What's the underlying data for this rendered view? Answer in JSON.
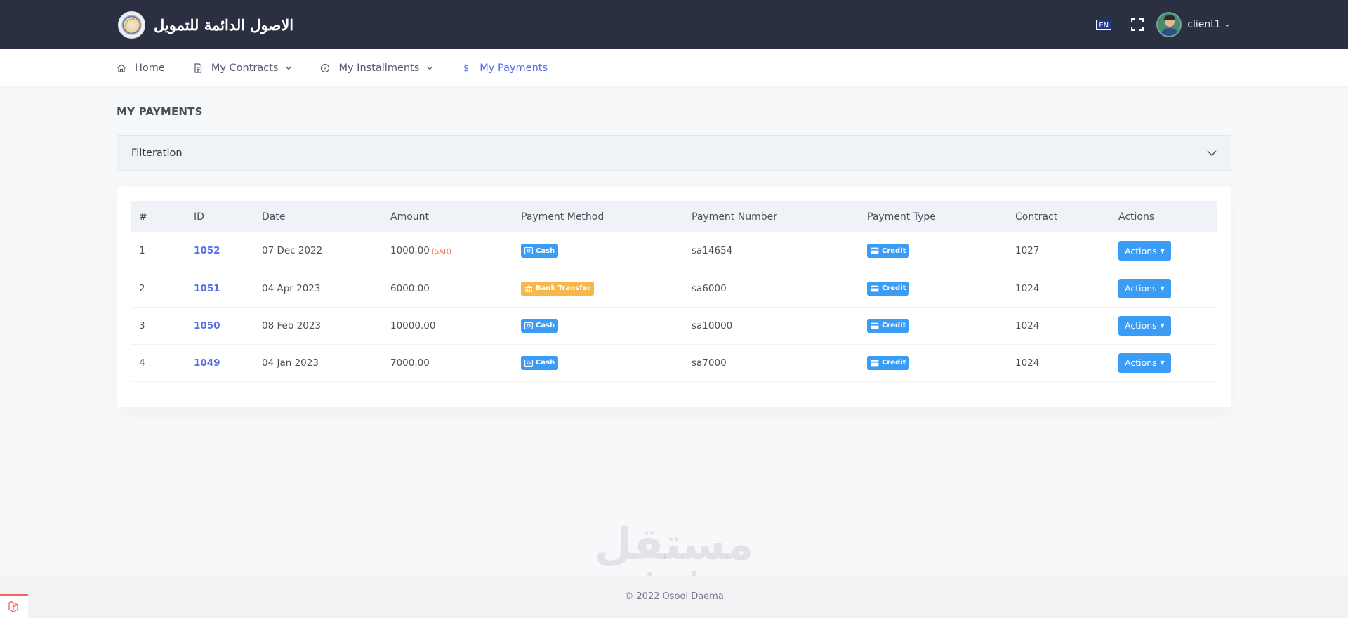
{
  "header": {
    "brand_text": "الاصول الدائمة للتمويل",
    "language": "EN",
    "user_name": "client1"
  },
  "nav": {
    "items": [
      {
        "label": "Home",
        "icon": "home-icon",
        "dropdown": false,
        "active": false
      },
      {
        "label": "My Contracts",
        "icon": "document-icon",
        "dropdown": true,
        "active": false
      },
      {
        "label": "My Installments",
        "icon": "coin-icon",
        "dropdown": true,
        "active": false
      },
      {
        "label": "My Payments",
        "icon": "dollar-icon",
        "dropdown": false,
        "active": true
      }
    ]
  },
  "page": {
    "title": "MY PAYMENTS",
    "filter_label": "Filteration"
  },
  "table": {
    "columns": [
      "#",
      "ID",
      "Date",
      "Amount",
      "Payment Method",
      "Payment Number",
      "Payment Type",
      "Contract",
      "Actions"
    ],
    "rows": [
      {
        "index": "1",
        "id": "1052",
        "date": "07 Dec 2022",
        "amount": "1000.00",
        "currency": "(SAR)",
        "method": "Cash",
        "payment_number": "sa14654",
        "type": "Credit",
        "contract": "1027",
        "action": "Actions"
      },
      {
        "index": "2",
        "id": "1051",
        "date": "04 Apr 2023",
        "amount": "6000.00",
        "currency": "",
        "method": "Bank Transfer",
        "payment_number": "sa6000",
        "type": "Credit",
        "contract": "1024",
        "action": "Actions"
      },
      {
        "index": "3",
        "id": "1050",
        "date": "08 Feb 2023",
        "amount": "10000.00",
        "currency": "",
        "method": "Cash",
        "payment_number": "sa10000",
        "type": "Credit",
        "contract": "1024",
        "action": "Actions"
      },
      {
        "index": "4",
        "id": "1049",
        "date": "04 Jan 2023",
        "amount": "7000.00",
        "currency": "",
        "method": "Cash",
        "payment_number": "sa7000",
        "type": "Credit",
        "contract": "1024",
        "action": "Actions"
      }
    ]
  },
  "footer": {
    "copyright": "© 2022 Osool Daema"
  },
  "watermark": {
    "arabic": "مستقل",
    "latin": "mostaql.com"
  },
  "colors": {
    "topbar": "#2a3042",
    "accent": "#556ee6",
    "badge_blue": "#3b9cf6",
    "badge_orange": "#f6b84b",
    "currency": "#f1734f"
  }
}
